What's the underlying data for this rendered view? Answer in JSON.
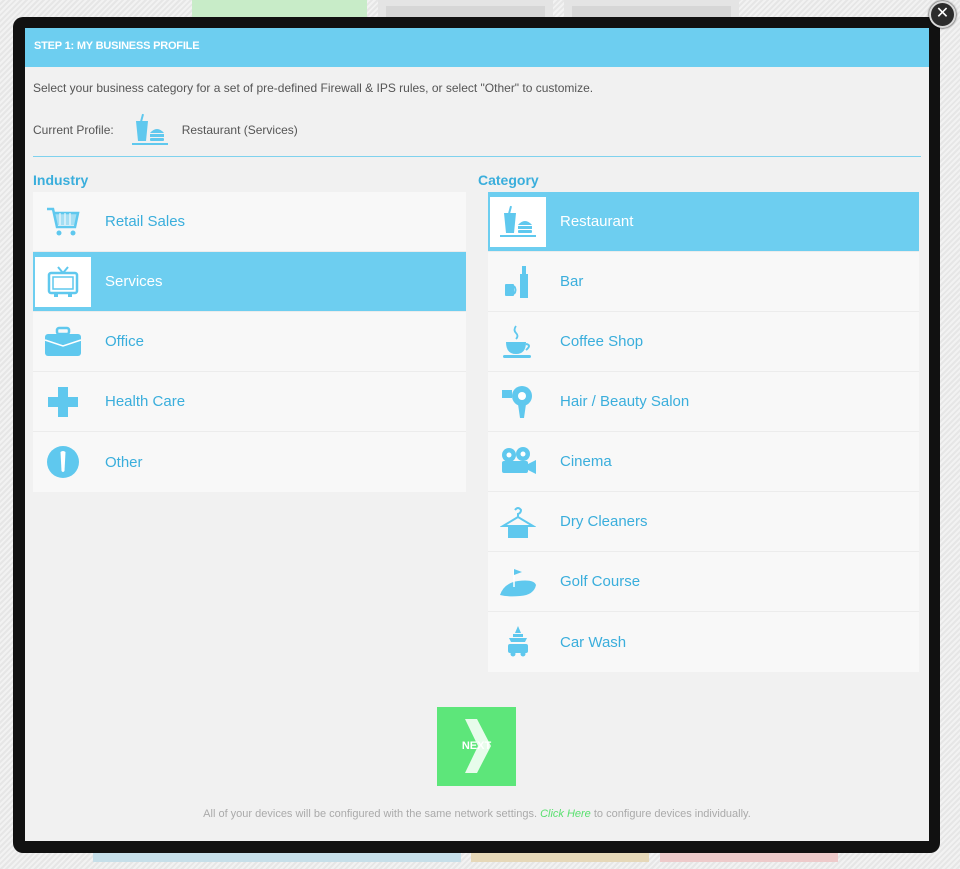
{
  "header": {
    "title": "STEP 1: MY BUSINESS PROFILE"
  },
  "intro_text": "Select your business category for a set of pre-defined Firewall & IPS rules, or select \"Other\" to customize.",
  "current_profile": {
    "label": "Current Profile:",
    "icon": "restaurant-icon",
    "value": "Restaurant (Services)"
  },
  "industry": {
    "title": "Industry",
    "items": [
      {
        "label": "Retail Sales",
        "icon": "shopping-cart-icon",
        "selected": false
      },
      {
        "label": "Services",
        "icon": "tv-icon",
        "selected": true
      },
      {
        "label": "Office",
        "icon": "briefcase-icon",
        "selected": false
      },
      {
        "label": "Health Care",
        "icon": "cross-icon",
        "selected": false
      },
      {
        "label": "Other",
        "icon": "exclamation-icon",
        "selected": false
      }
    ]
  },
  "category": {
    "title": "Category",
    "items": [
      {
        "label": "Restaurant",
        "icon": "restaurant-icon",
        "selected": true
      },
      {
        "label": "Bar",
        "icon": "bottle-icon",
        "selected": false
      },
      {
        "label": "Coffee Shop",
        "icon": "coffee-cup-icon",
        "selected": false
      },
      {
        "label": "Hair / Beauty Salon",
        "icon": "hair-dryer-icon",
        "selected": false
      },
      {
        "label": "Cinema",
        "icon": "film-camera-icon",
        "selected": false
      },
      {
        "label": "Dry Cleaners",
        "icon": "hanger-icon",
        "selected": false
      },
      {
        "label": "Golf Course",
        "icon": "golf-flag-icon",
        "selected": false
      },
      {
        "label": "Car Wash",
        "icon": "car-wash-icon",
        "selected": false
      }
    ]
  },
  "next_button": {
    "label": "NEXT"
  },
  "footer": {
    "before": "All of your devices will be configured with the same network settings.",
    "link": "Click Here",
    "after": "to configure devices individually."
  },
  "colors": {
    "accent": "#6dcef0",
    "text_accent": "#3aaedc",
    "next": "#5de67a",
    "link": "#59e06f"
  }
}
